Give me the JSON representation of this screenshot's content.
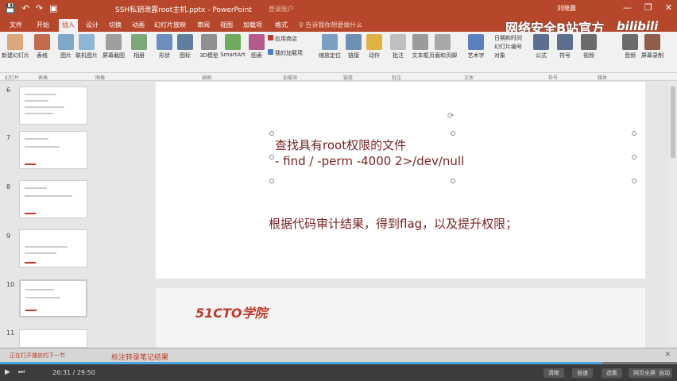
{
  "window": {
    "title": "SSH私钥泄露root主机.pptx - PowerPoint",
    "signin": "登录账户",
    "user": "刘晓晨",
    "controls": [
      "—",
      "❐",
      "✕"
    ],
    "quick_access": [
      "💾",
      "↶",
      "↷",
      "▣"
    ]
  },
  "tabs": [
    "文件",
    "开始",
    "插入",
    "设计",
    "切换",
    "动画",
    "幻灯片放映",
    "审阅",
    "视图",
    "加载项",
    "格式"
  ],
  "active_tab": "插入",
  "tell_me": "♀ 告诉我你想要做什么",
  "watermark": "网络安全B站官方",
  "bili_logo": "bilibili",
  "ribbon": {
    "buttons": [
      {
        "label": "新建幻灯片",
        "icon": "new-slide-icon",
        "color": "#d9a77a"
      },
      {
        "label": "表格",
        "icon": "table-icon",
        "color": "#c46b4e"
      },
      {
        "label": "图片",
        "icon": "picture-icon",
        "color": "#7fa7c6"
      },
      {
        "label": "联机图片",
        "icon": "online-picture-icon",
        "color": "#8db6d6"
      },
      {
        "label": "屏幕截图",
        "icon": "screenshot-icon",
        "color": "#9e9e9e"
      },
      {
        "label": "相册",
        "icon": "album-icon",
        "color": "#7da87a"
      },
      {
        "label": "形状",
        "icon": "shapes-icon",
        "color": "#6c8ebf"
      },
      {
        "label": "图标",
        "icon": "icons-icon",
        "color": "#5f7f9f"
      },
      {
        "label": "3D模型",
        "icon": "3d-model-icon",
        "color": "#8f8f8f"
      },
      {
        "label": "SmartArt",
        "icon": "smartart-icon",
        "color": "#6faa5d"
      },
      {
        "label": "图表",
        "icon": "chart-icon",
        "color": "#b65a8c"
      },
      {
        "label": "缩放定位",
        "icon": "zoom-icon",
        "color": "#7b9ec3"
      },
      {
        "label": "链接",
        "icon": "link-icon",
        "color": "#6d8fb3"
      },
      {
        "label": "动作",
        "icon": "action-icon",
        "color": "#e0b340"
      },
      {
        "label": "批注",
        "icon": "comment-icon",
        "color": "#bfbfbf"
      },
      {
        "label": "文本框",
        "icon": "textbox-icon",
        "color": "#9a9a9a"
      },
      {
        "label": "页眉和页脚",
        "icon": "header-footer-icon",
        "color": "#a8a8a8"
      },
      {
        "label": "艺术字",
        "icon": "wordart-icon",
        "color": "#5b7fbf"
      },
      {
        "label": "公式",
        "icon": "formula-icon",
        "color": "#5c6f8e"
      },
      {
        "label": "符号",
        "icon": "symbol-icon",
        "color": "#5c6f8e"
      },
      {
        "label": "视频",
        "icon": "video-icon",
        "color": "#6b6b6b"
      },
      {
        "label": "音频",
        "icon": "audio-icon",
        "color": "#6b6b6b"
      },
      {
        "label": "屏幕录制",
        "icon": "screen-record-icon",
        "color": "#8e5d4b"
      }
    ],
    "addins": {
      "store": "应用商店",
      "my_addins": "我的加载项"
    },
    "insert_list": [
      "日期和时间",
      "幻灯片编号",
      "对象"
    ]
  },
  "group_labels": [
    "幻灯片",
    "表格",
    "图像",
    "插图",
    "加载项",
    "链接",
    "批注",
    "文本",
    "符号",
    "媒体"
  ],
  "thumbnails": [
    "6",
    "7",
    "8",
    "9",
    "10",
    "11"
  ],
  "selected_thumbnail": "10",
  "slide": {
    "line1": "查找具有root权限的文件",
    "line2": "- find / -perm -4000 2>/dev/null",
    "line3": "根据代码审计结果，得到flag，以及提升权限；"
  },
  "next_slide": {
    "brand": "51CTO学院"
  },
  "notify": {
    "left": "正在打开播放的下一节",
    "right": "标注转录笔记结果"
  },
  "status": {
    "time": "26:31 / 29:50",
    "buttons": [
      "清晰",
      "倍速",
      "选集",
      "网页全屏",
      "自动"
    ],
    "progress_pct": 89
  }
}
